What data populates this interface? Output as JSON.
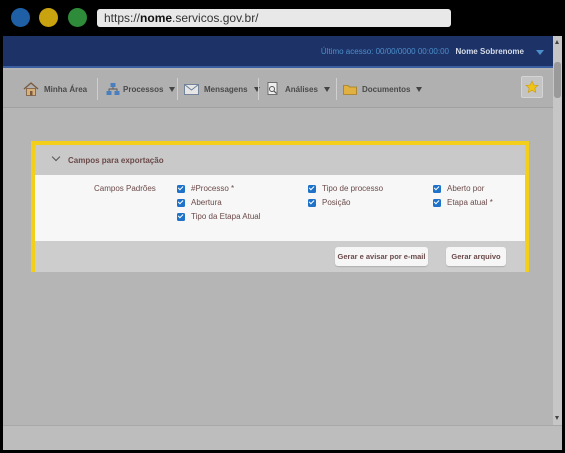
{
  "window": {
    "url_prefix": "https://",
    "url_host": "nome",
    "url_rest": ".servicos.gov.br/",
    "traffic_colors": {
      "blue": "#1e5fa6",
      "yellow": "#c8a20f",
      "green": "#2e8b3a"
    }
  },
  "topbar": {
    "last_access": "Último acesso: 00/00/0000 00:00:00",
    "user_name": "Nome Sobrenome"
  },
  "nav": {
    "items": [
      {
        "label": "Minha Área",
        "icon": "home-icon"
      },
      {
        "label": "Processos",
        "icon": "org-chart-icon"
      },
      {
        "label": "Mensagens",
        "icon": "envelope-icon"
      },
      {
        "label": "Análises",
        "icon": "document-search-icon"
      },
      {
        "label": "Documentos",
        "icon": "folder-icon"
      }
    ],
    "favorite_icon": "star-icon"
  },
  "panel": {
    "title": "Campos para exportação",
    "row_label": "Campos Padrões",
    "options": [
      {
        "label": "#Processo *",
        "checked": true
      },
      {
        "label": "Tipo de processo",
        "checked": true
      },
      {
        "label": "Aberto por",
        "checked": true
      },
      {
        "label": "Abertura",
        "checked": true
      },
      {
        "label": "Posição",
        "checked": true
      },
      {
        "label": "Etapa atual *",
        "checked": true
      },
      {
        "label": "Tipo da Etapa Atual",
        "checked": true
      }
    ],
    "button_email": "Gerar e avisar por e-mail",
    "button_file": "Gerar arquivo"
  },
  "colors": {
    "highlight": "#f3cf1a",
    "topbar": "#1d3367",
    "checkbox": "#1e72c8",
    "accent_text": "#4c8ecb"
  }
}
